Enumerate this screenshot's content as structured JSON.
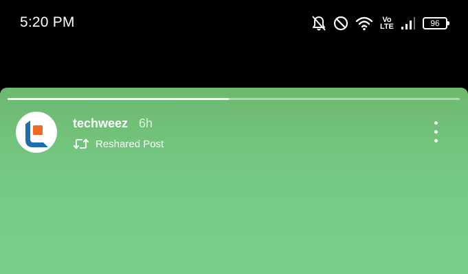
{
  "status_bar": {
    "time": "5:20 PM",
    "volte_top": "Vo",
    "volte_bottom": "LTE",
    "battery_level": "96",
    "icons": [
      "notifications-off-icon",
      "do-not-disturb-icon",
      "wifi-icon",
      "volte-icon",
      "signal-icon",
      "battery-icon"
    ]
  },
  "story": {
    "progress": 0.49,
    "username": "techweez",
    "time_ago": "6h",
    "reshare_label": "Reshared Post",
    "background_colors": [
      "#6db86f",
      "#78d08c"
    ],
    "avatar_icon": "techweez-logo",
    "more_icon": "more-vertical-icon"
  }
}
